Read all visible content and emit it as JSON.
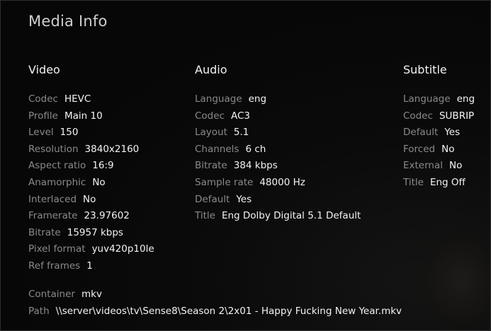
{
  "title": "Media Info",
  "video": {
    "heading": "Video",
    "rows": [
      {
        "label": "Codec",
        "value": "HEVC"
      },
      {
        "label": "Profile",
        "value": "Main 10"
      },
      {
        "label": "Level",
        "value": "150"
      },
      {
        "label": "Resolution",
        "value": "3840x2160"
      },
      {
        "label": "Aspect ratio",
        "value": "16:9"
      },
      {
        "label": "Anamorphic",
        "value": "No"
      },
      {
        "label": "Interlaced",
        "value": "No"
      },
      {
        "label": "Framerate",
        "value": "23.97602"
      },
      {
        "label": "Bitrate",
        "value": "15957 kbps"
      },
      {
        "label": "Pixel format",
        "value": "yuv420p10le"
      },
      {
        "label": "Ref frames",
        "value": "1"
      }
    ]
  },
  "audio": {
    "heading": "Audio",
    "rows": [
      {
        "label": "Language",
        "value": "eng"
      },
      {
        "label": "Codec",
        "value": "AC3"
      },
      {
        "label": "Layout",
        "value": "5.1"
      },
      {
        "label": "Channels",
        "value": "6 ch"
      },
      {
        "label": "Bitrate",
        "value": "384 kbps"
      },
      {
        "label": "Sample rate",
        "value": "48000 Hz"
      },
      {
        "label": "Default",
        "value": "Yes"
      },
      {
        "label": "Title",
        "value": "Eng Dolby Digital 5.1 Default"
      }
    ]
  },
  "subtitle": {
    "heading": "Subtitle",
    "rows": [
      {
        "label": "Language",
        "value": "eng"
      },
      {
        "label": "Codec",
        "value": "SUBRIP"
      },
      {
        "label": "Default",
        "value": "Yes"
      },
      {
        "label": "Forced",
        "value": "No"
      },
      {
        "label": "External",
        "value": "No"
      },
      {
        "label": "Title",
        "value": "Eng Off"
      }
    ]
  },
  "file": {
    "container_label": "Container",
    "container_value": "mkv",
    "path_label": "Path",
    "path_value": "\\\\server\\videos\\tv\\Sense8\\Season 2\\2x01 - Happy Fucking New Year.mkv"
  }
}
